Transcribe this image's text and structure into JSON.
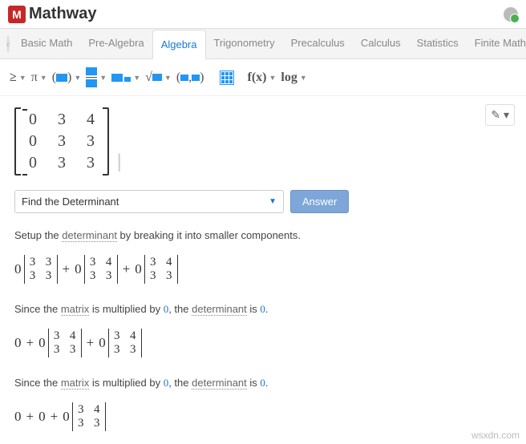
{
  "brand": {
    "icon": "M",
    "name": "Mathway"
  },
  "tabs": {
    "items": [
      "Basic Math",
      "Pre-Algebra",
      "Algebra",
      "Trigonometry",
      "Precalculus",
      "Calculus",
      "Statistics",
      "Finite Math"
    ],
    "active": 2
  },
  "toolbar": {
    "geq": "≥",
    "pi": "π",
    "paren": "(▪)",
    "sqrt": "√▪",
    "interval": "(▪,▪)",
    "fx": "f(x)",
    "log": "log"
  },
  "matrix": {
    "rows": [
      [
        "0",
        "3",
        "4"
      ],
      [
        "0",
        "3",
        "3"
      ],
      [
        "0",
        "3",
        "3"
      ]
    ]
  },
  "edit_icon": "✎ ▾",
  "select": {
    "label": "Find the Determinant"
  },
  "answer_label": "Answer",
  "steps": [
    {
      "text_parts": [
        "Setup the ",
        "determinant",
        " by breaking it into smaller components."
      ],
      "underline_idx": [
        1
      ],
      "expr": [
        {
          "t": "coef",
          "v": "0"
        },
        {
          "t": "det",
          "rows": [
            [
              "3",
              "3"
            ],
            [
              "3",
              "3"
            ]
          ]
        },
        {
          "t": "op",
          "v": "+"
        },
        {
          "t": "coef",
          "v": "0"
        },
        {
          "t": "det",
          "rows": [
            [
              "3",
              "4"
            ],
            [
              "3",
              "3"
            ]
          ]
        },
        {
          "t": "op",
          "v": "+"
        },
        {
          "t": "coef",
          "v": "0"
        },
        {
          "t": "det",
          "rows": [
            [
              "3",
              "4"
            ],
            [
              "3",
              "3"
            ]
          ]
        }
      ]
    },
    {
      "text_parts": [
        "Since the ",
        "matrix",
        " is multiplied by ",
        "0",
        ", the ",
        "determinant",
        " is ",
        "0",
        "."
      ],
      "underline_idx": [
        1,
        5
      ],
      "blue_idx": [
        3,
        7
      ],
      "expr": [
        {
          "t": "coef",
          "v": "0"
        },
        {
          "t": "op",
          "v": "+"
        },
        {
          "t": "coef",
          "v": "0"
        },
        {
          "t": "det",
          "rows": [
            [
              "3",
              "4"
            ],
            [
              "3",
              "3"
            ]
          ]
        },
        {
          "t": "op",
          "v": "+"
        },
        {
          "t": "coef",
          "v": "0"
        },
        {
          "t": "det",
          "rows": [
            [
              "3",
              "4"
            ],
            [
              "3",
              "3"
            ]
          ]
        }
      ]
    },
    {
      "text_parts": [
        "Since the ",
        "matrix",
        " is multiplied by ",
        "0",
        ", the ",
        "determinant",
        " is ",
        "0",
        "."
      ],
      "underline_idx": [
        1,
        5
      ],
      "blue_idx": [
        3,
        7
      ],
      "expr": [
        {
          "t": "coef",
          "v": "0"
        },
        {
          "t": "op",
          "v": "+"
        },
        {
          "t": "coef",
          "v": "0"
        },
        {
          "t": "op",
          "v": "+"
        },
        {
          "t": "coef",
          "v": "0"
        },
        {
          "t": "det",
          "rows": [
            [
              "3",
              "4"
            ],
            [
              "3",
              "3"
            ]
          ]
        }
      ]
    }
  ],
  "watermark": "wsxdn.com"
}
